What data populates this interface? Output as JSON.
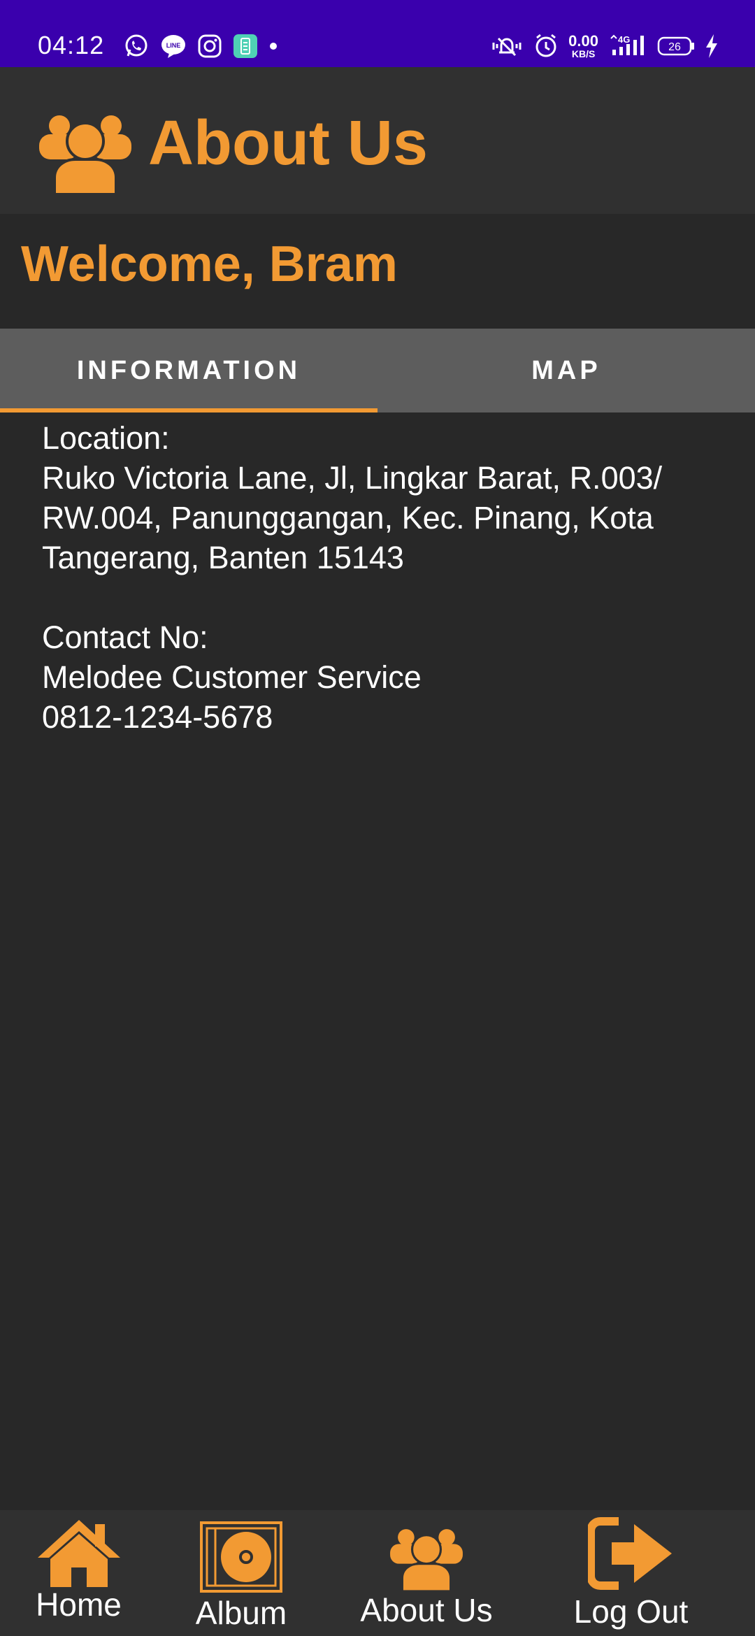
{
  "status_bar": {
    "time": "04:12",
    "net_speed_value": "0.00",
    "net_speed_unit": "KB/S",
    "network_type": "4G",
    "battery_level": "26",
    "left_icons": [
      "whatsapp-icon",
      "line-icon",
      "instagram-icon",
      "app-notification-icon",
      "more-dot-icon"
    ],
    "right_icons": [
      "vibrate-icon",
      "alarm-icon",
      "signal-icon",
      "battery-icon",
      "charging-icon"
    ],
    "background_color": "#3a00ad"
  },
  "app_bar": {
    "title": "About Us",
    "icon": "group-icon"
  },
  "welcome": {
    "text": "Welcome, Bram"
  },
  "tabs": [
    {
      "label": "INFORMATION",
      "selected": true
    },
    {
      "label": "MAP",
      "selected": false
    }
  ],
  "info": {
    "location_label": "Location:",
    "address_lines": [
      "Ruko Victoria Lane, Jl, Lingkar Barat, R.003/",
      "RW.004, Panunggangan, Kec. Pinang, Kota",
      "Tangerang, Banten 15143"
    ],
    "contact_label": "Contact No:",
    "contact_name": "Melodee Customer Service",
    "contact_number": "0812-1234-5678"
  },
  "bottom_nav": [
    {
      "label": "Home",
      "icon": "home-icon"
    },
    {
      "label": "Album",
      "icon": "album-icon"
    },
    {
      "label": "About Us",
      "icon": "group-icon"
    },
    {
      "label": "Log Out",
      "icon": "logout-icon"
    }
  ],
  "colors": {
    "accent": "#f29a33",
    "background": "#282828",
    "app_bar": "#303030",
    "tab_bar": "#5d5d5d",
    "text": "#ffffff"
  }
}
